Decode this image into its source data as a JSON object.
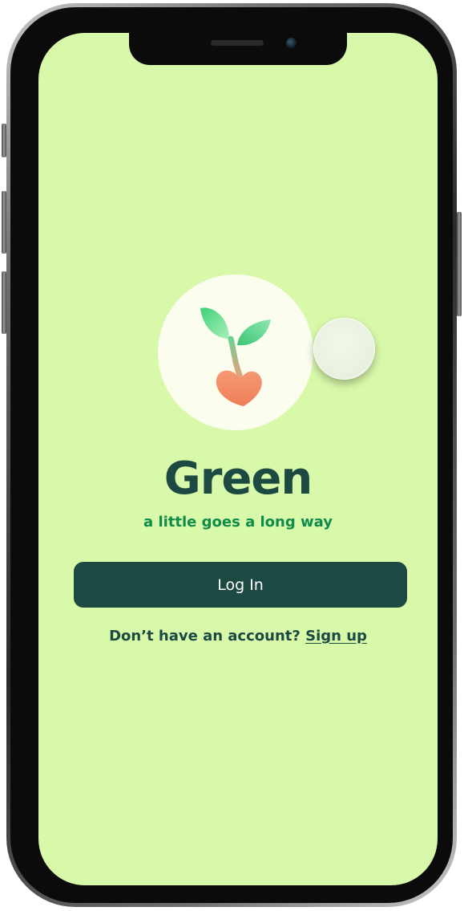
{
  "app": {
    "title": "Green",
    "tagline": "a little goes a long way"
  },
  "auth": {
    "login_label": "Log In",
    "signup_prompt": "Don’t have an account?",
    "signup_label": "Sign up"
  },
  "colors": {
    "screen_background": "#d8f8aa",
    "primary_dark": "#1c4a43",
    "tagline_green": "#0f8b4a",
    "logo_circle": "#fbfdee",
    "leaf_green": "#5fcf89",
    "heart_orange": "#f3875f"
  },
  "icons": {
    "logo": "sprout-heart-icon"
  }
}
